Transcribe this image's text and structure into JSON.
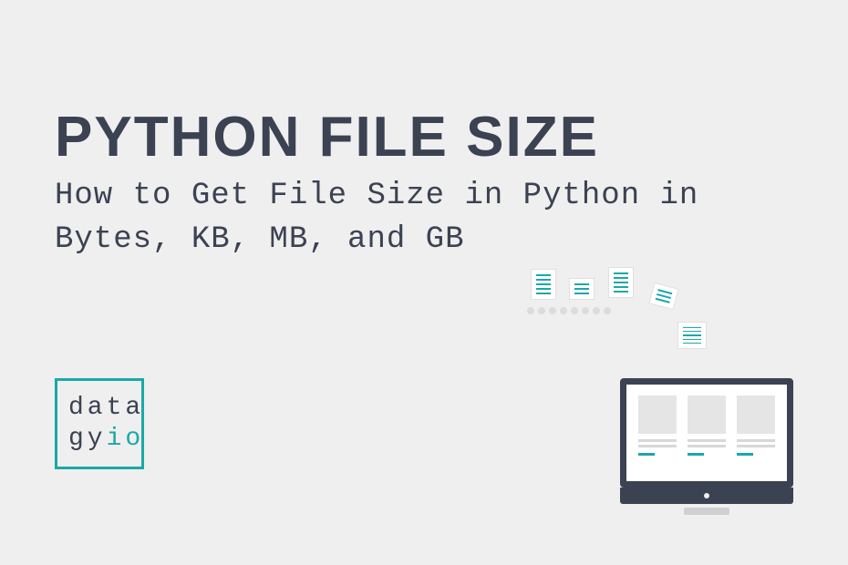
{
  "title": "PYTHON FILE SIZE",
  "subtitle": "How to Get File Size in Python in Bytes, KB, MB, and GB",
  "logo": {
    "line1": "data",
    "line2_prefix": "gy",
    "line2_suffix": "io"
  }
}
